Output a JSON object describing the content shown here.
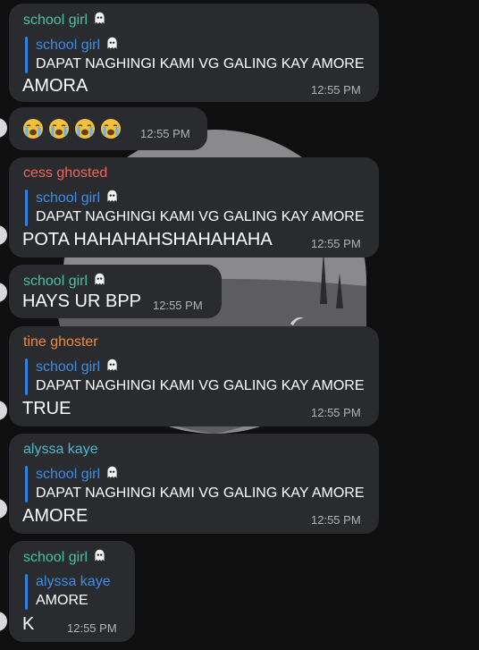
{
  "colors": {
    "background": "#0f0f10",
    "bubble": "#2a2b2f",
    "timestamp": "#b3b3b5",
    "reply_accent": "#2f82e0",
    "name_school_girl": "#47c2a6",
    "name_cess_ghosted": "#f1665c",
    "name_tine_ghoster": "#f08a38",
    "name_alyssa_kaye": "#4fb8c8"
  },
  "messages": [
    {
      "sender": "school girl",
      "sender_icon": "ghost-icon",
      "reply": {
        "name": "school girl",
        "name_icon": "ghost-icon",
        "text": "DAPAT NAGHINGI KAMI VG GALING KAY AMORE"
      },
      "text": "AMORA",
      "time": "12:55 PM"
    },
    {
      "emojis": [
        "loudly-crying-face-icon",
        "loudly-crying-face-icon",
        "loudly-crying-face-icon",
        "loudly-crying-face-icon"
      ],
      "time": "12:55 PM"
    },
    {
      "sender": "cess ghosted",
      "reply": {
        "name": "school girl",
        "name_icon": "ghost-icon",
        "text": "DAPAT NAGHINGI KAMI VG GALING KAY AMORE"
      },
      "text": "POTA HAHAHAHSHAHAHAHA",
      "time": "12:55 PM"
    },
    {
      "sender": "school girl",
      "sender_icon": "ghost-icon",
      "text": "HAYS UR BPP",
      "time": "12:55 PM"
    },
    {
      "sender": "tine ghoster",
      "reply": {
        "name": "school girl",
        "name_icon": "ghost-icon",
        "text": "DAPAT NAGHINGI KAMI VG GALING KAY AMORE"
      },
      "text": "TRUE",
      "time": "12:55 PM"
    },
    {
      "sender": "alyssa kaye",
      "reply": {
        "name": "school girl",
        "name_icon": "ghost-icon",
        "text": "DAPAT NAGHINGI KAMI VG GALING KAY AMORE"
      },
      "text": "AMORE",
      "time": "12:55 PM"
    },
    {
      "sender": "school girl",
      "sender_icon": "ghost-icon",
      "reply": {
        "name": "alyssa kaye",
        "text": "AMORE"
      },
      "text": "K",
      "time": "12:55 PM"
    }
  ]
}
